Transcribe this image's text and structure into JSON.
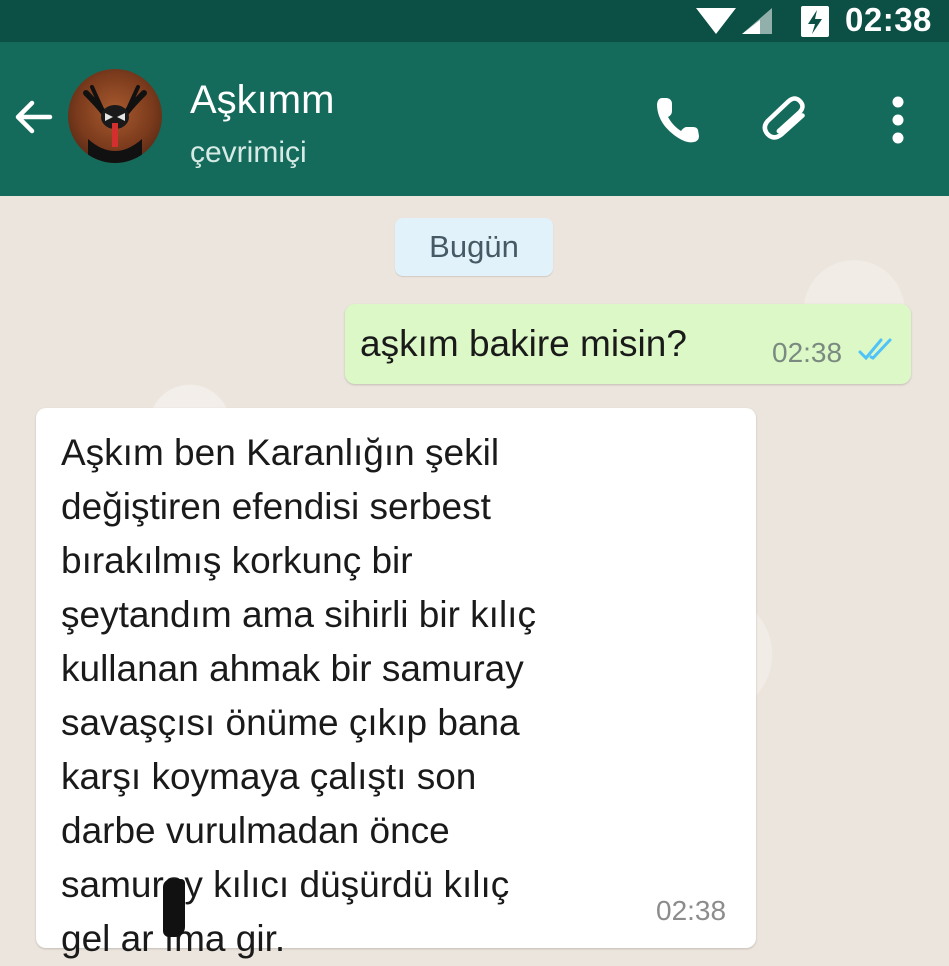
{
  "status_bar": {
    "time": "02:38",
    "signal_icon": "signal-icon",
    "battery_icon": "battery-charging-icon"
  },
  "header": {
    "back_icon": "back-arrow-icon",
    "avatar_icon": "contact-avatar",
    "contact_name": "Aşkımm",
    "status": "çevrimiçi",
    "call_icon": "phone-icon",
    "attach_icon": "paperclip-icon",
    "menu_icon": "more-vertical-icon"
  },
  "chat": {
    "date_divider": "Bugün",
    "messages": [
      {
        "direction": "outgoing",
        "text": "aşkım bakire misin?",
        "time": "02:38",
        "read_status_icon": "double-check-icon"
      },
      {
        "direction": "incoming",
        "text": "Aşkım ben Karanlığın şekil\ndeğiştiren efendisi serbest\nbırakılmış korkunç bir\nşeytandım ama sihirli bir kılıç\nkullanan ahmak bir samuray\nsavaşçısı önüme çıkıp bana\nkarşı koymaya çalıştı son\ndarbe vurulmadan önce\nsamuray kılıcı düşürdü kılıç\ngel ar ıma gir.",
        "time": "02:38"
      }
    ]
  },
  "colors": {
    "status_bar": "#0c4f45",
    "header": "#146b5b",
    "chat_background": "#ece5dd",
    "outgoing_bubble": "#dcf8c6",
    "incoming_bubble": "#ffffff",
    "date_chip": "#e1f2fb",
    "read_ticks": "#4fc3f7"
  }
}
